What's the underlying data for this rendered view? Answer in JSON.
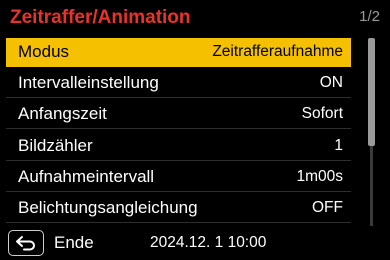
{
  "header": {
    "title": "Zeitraffer/Animation",
    "page": "1/2"
  },
  "menu": {
    "items": [
      {
        "label": "Modus",
        "value": "Zeitrafferaufnahme",
        "selected": true
      },
      {
        "label": "Intervalleinstellung",
        "value": "ON"
      },
      {
        "label": "Anfangszeit",
        "value": "Sofort"
      },
      {
        "label": "Bildzähler",
        "value": "1"
      },
      {
        "label": "Aufnahmeintervall",
        "value": "1m00s"
      },
      {
        "label": "Belichtungsangleichung",
        "value": "OFF"
      }
    ]
  },
  "footer": {
    "back_icon": "return-arrow-icon",
    "label": "Ende",
    "datetime": "2024.12. 1 10:00"
  },
  "colors": {
    "title": "#e8322b",
    "selection": "#f4c000",
    "background": "#000000"
  }
}
